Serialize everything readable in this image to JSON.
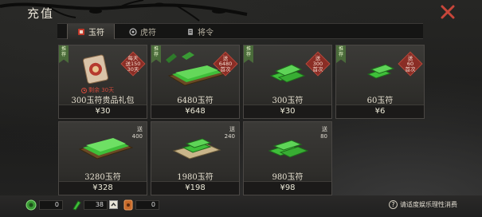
{
  "header": {
    "title": "充值"
  },
  "tabs": [
    {
      "label": "玉符",
      "icon": "jade-tab-icon",
      "active": true
    },
    {
      "label": "虎符",
      "icon": "tiger-tab-icon",
      "active": false
    },
    {
      "label": "将令",
      "icon": "token-tab-icon",
      "active": false
    }
  ],
  "products": [
    {
      "name": "300玉符贵品礼包",
      "price": "¥30",
      "ribbon": "推荐",
      "badge": [
        "每天",
        "送150",
        "30天"
      ],
      "timer": "剩余 30天",
      "icon": "gift-pack-icon"
    },
    {
      "name": "6480玉符",
      "price": "¥648",
      "ribbon": "推荐",
      "badge": [
        "送",
        "6480",
        "首次"
      ],
      "icon": "jade-chest-icon"
    },
    {
      "name": "300玉符",
      "price": "¥30",
      "ribbon": "推荐",
      "badge": [
        "送",
        "300",
        "首次"
      ],
      "icon": "jade-bundle-icon"
    },
    {
      "name": "60玉符",
      "price": "¥6",
      "ribbon": "推荐",
      "badge": [
        "送",
        "60",
        "首次"
      ],
      "icon": "jade-small-icon"
    },
    {
      "name": "3280玉符",
      "price": "¥328",
      "bonus": [
        "送",
        "400"
      ],
      "icon": "jade-tray-large-icon"
    },
    {
      "name": "1980玉符",
      "price": "¥198",
      "bonus": [
        "送",
        "240"
      ],
      "icon": "jade-tray-icon"
    },
    {
      "name": "980玉符",
      "price": "¥98",
      "bonus": [
        "送",
        "80"
      ],
      "icon": "jade-pile-icon"
    }
  ],
  "resources": [
    {
      "icon": "coin-icon",
      "value": "0"
    },
    {
      "icon": "jade-icon",
      "value": "38"
    },
    {
      "icon": "tiger-token-icon",
      "value": "0"
    }
  ],
  "footer": {
    "hint": "请适度娱乐理性消费"
  },
  "colors": {
    "accent_red": "#d44a3c",
    "jade_green": "#3fbf3a",
    "badge_red": "#8a2d25"
  }
}
